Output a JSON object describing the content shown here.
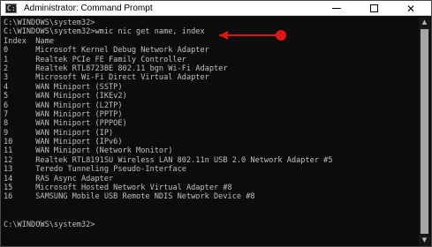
{
  "window": {
    "title": "Administrator: Command Prompt",
    "icon_name": "cmd-icon",
    "icon_text": "C:\\",
    "controls": {
      "minimize_icon": "minimize-icon",
      "maximize_icon": "maximize-icon",
      "close_icon": "close-icon",
      "close_glyph": "✕"
    }
  },
  "console": {
    "lines": [
      "C:\\WINDOWS\\system32>",
      "C:\\WINDOWS\\system32>wmic nic get name, index",
      "Index  Name",
      "0      Microsoft Kernel Debug Network Adapter",
      "1      Realtek PCIe FE Family Controller",
      "2      Realtek RTL8723BE 802.11 bgn Wi-Fi Adapter",
      "3      Microsoft Wi-Fi Direct Virtual Adapter",
      "4      WAN Miniport (SSTP)",
      "5      WAN Miniport (IKEv2)",
      "6      WAN Miniport (L2TP)",
      "7      WAN Miniport (PPTP)",
      "8      WAN Miniport (PPPOE)",
      "9      WAN Miniport (IP)",
      "10     WAN Miniport (IPv6)",
      "11     WAN Miniport (Network Monitor)",
      "12     Realtek RTL8191SU Wireless LAN 802.11n USB 2.0 Network Adapter #5",
      "13     Teredo Tunneling Pseudo-Interface",
      "14     RAS Async Adapter",
      "15     Microsoft Hosted Network Virtual Adapter #8",
      "16     SAMSUNG Mobile USB Remote NDIS Network Device #8",
      "",
      "",
      "C:\\WINDOWS\\system32>"
    ]
  },
  "scrollbar": {
    "up_icon": "scroll-up-arrow-icon",
    "down_icon": "scroll-down-arrow-icon",
    "up_glyph": "▲",
    "down_glyph": "▼"
  },
  "annotation": {
    "color": "#e41414",
    "icon_name": "red-arrow-pointer-icon"
  },
  "colors": {
    "console_bg": "#0c0c0c",
    "console_text": "#c0c0c0",
    "titlebar_bg": "#ffffff"
  }
}
